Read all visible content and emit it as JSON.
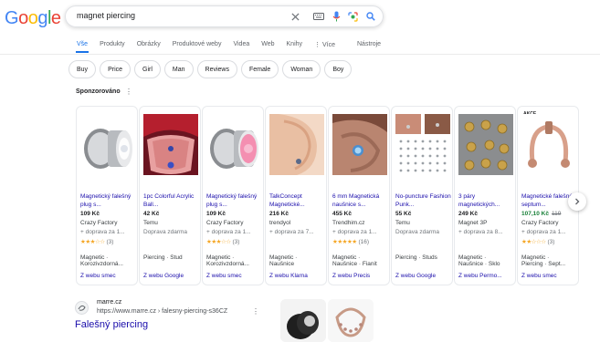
{
  "logo": {
    "letters": [
      "G",
      "o",
      "o",
      "g",
      "l",
      "e"
    ],
    "colors": [
      "#4285f4",
      "#ea4335",
      "#fbbc05",
      "#4285f4",
      "#34a853",
      "#ea4335"
    ]
  },
  "search": {
    "query": "magnet piercing"
  },
  "icons": {
    "clear": "close-icon",
    "keyboard": "keyboard-icon",
    "mic": "mic-icon",
    "lens": "lens-icon",
    "search": "search-icon"
  },
  "tabs": [
    "Vše",
    "Produkty",
    "Obrázky",
    "Produktové weby",
    "Videa",
    "Web",
    "Knihy",
    "⋮ Více"
  ],
  "tools": "Nástroje",
  "chips": [
    "Buy",
    "Price",
    "Girl",
    "Man",
    "Reviews",
    "Female",
    "Woman",
    "Boy"
  ],
  "sponsored": {
    "label": "Sponzorováno",
    "menu": "⋮"
  },
  "products": [
    {
      "title": "Magnetický falešný plug s...",
      "price": "109 Kč",
      "store": "Crazy Factory",
      "shipping": "+ doprava za 1...",
      "stars": "★★★☆☆",
      "reviews": "(3)",
      "tags1": "Magnetic ·",
      "tags2": "Korozivzdorná...",
      "link": "Z webu smec"
    },
    {
      "title": "1pc Colorful Acrylic Ball...",
      "price": "42 Kč",
      "store": "Temu",
      "shipping": "Doprava zdarma",
      "stars": "",
      "reviews": "",
      "tags1": "Piercing · Stud",
      "tags2": "",
      "link": "Z webu Google"
    },
    {
      "title": "Magnetický falešný plug s...",
      "price": "109 Kč",
      "store": "Crazy Factory",
      "shipping": "+ doprava za 1...",
      "stars": "★★★☆☆",
      "reviews": "(3)",
      "tags1": "Magnetic ·",
      "tags2": "Korozivzdorná...",
      "link": "Z webu smec"
    },
    {
      "title": "TalkConcept Magnetické...",
      "price": "216 Kč",
      "store": "trendyol",
      "shipping": "+ doprava za 7...",
      "stars": "",
      "reviews": "",
      "tags1": "Magnetic ·",
      "tags2": "Naušnice",
      "link": "Z webu Klarna"
    },
    {
      "title": "6 mm Magnetická naušnice s...",
      "price": "455 Kč",
      "store": "Trendhim.cz",
      "shipping": "+ doprava za 1...",
      "stars": "★★★★★",
      "reviews": "(16)",
      "tags1": "Magnetic ·",
      "tags2": "Naušnice · Fianit",
      "link": "Z webu Precis"
    },
    {
      "title": "No-puncture Fashion Punk...",
      "price": "55 Kč",
      "store": "Temu",
      "shipping": "Doprava zdarma",
      "stars": "",
      "reviews": "",
      "tags1": "Piercing · Studs",
      "tags2": "",
      "link": "Z webu Google"
    },
    {
      "title": "3 páry magnetických...",
      "price": "249 Kč",
      "store": "Magnet 3P",
      "shipping": "+ doprava za 8...",
      "stars": "",
      "reviews": "",
      "tags1": "Magnetic ·",
      "tags2": "Naušnice · Sklo",
      "link": "Z webu Permo..."
    },
    {
      "title": "Magnetické falešné septum...",
      "price": "107,10 Kč",
      "old_price": "119",
      "store": "Crazy Factory",
      "shipping": "+ doprava za 1...",
      "stars": "★★☆☆☆",
      "reviews": "(3)",
      "tags1": "Magnetic ·",
      "tags2": "Piercing · Sept...",
      "link": "Z webu smec",
      "badge": "AKCE"
    }
  ],
  "organic": {
    "site": "marre.cz",
    "url": "https://www.marre.cz › falesny-piercing-s36CZ",
    "menu": "⋮",
    "title": "Falešný piercing"
  }
}
